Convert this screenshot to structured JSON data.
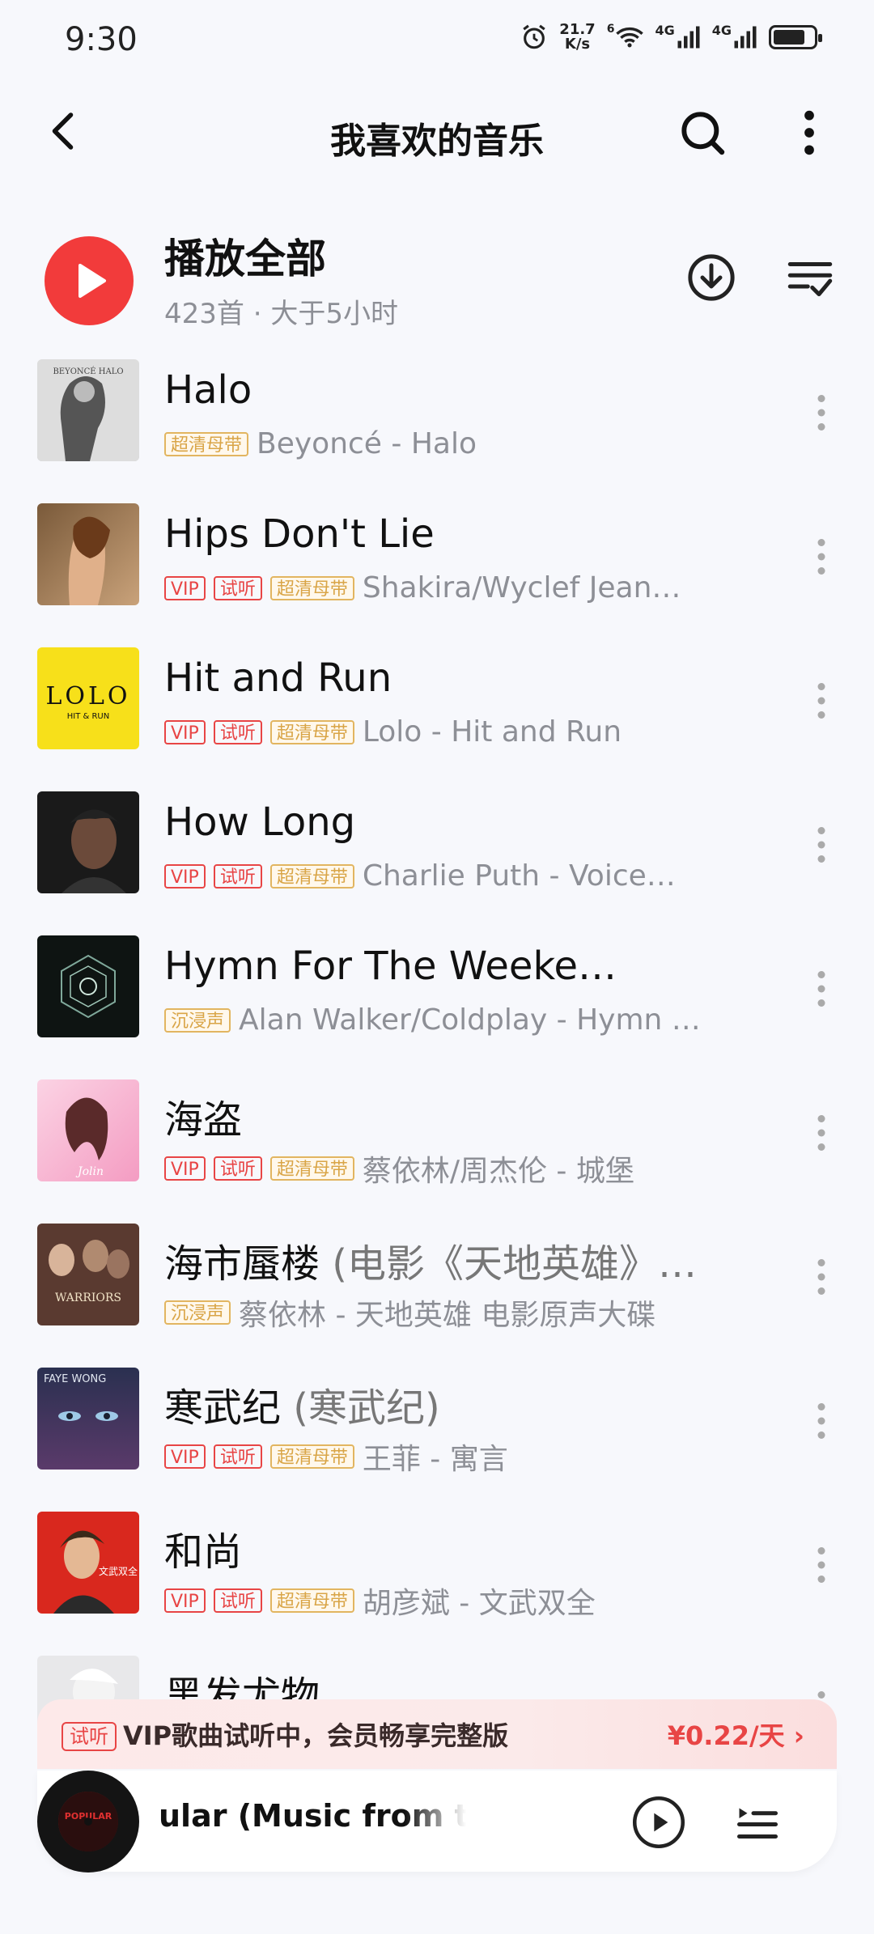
{
  "status_bar": {
    "time": "9:30",
    "net_speed_value": "21.7",
    "net_speed_unit": "K/s",
    "wifi_label": "6",
    "signal1": "4G",
    "signal2": "4G",
    "icons": [
      "alarm-icon",
      "wifi-icon",
      "signal-icon",
      "signal-icon",
      "battery-icon"
    ]
  },
  "header": {
    "title": "我喜欢的音乐",
    "back_icon": "chevron-left-icon",
    "search_icon": "search-icon",
    "more_icon": "more-vertical-icon"
  },
  "play_all": {
    "label": "播放全部",
    "subtitle": "423首 · 大于5小时",
    "download_icon": "download-icon",
    "multiselect_icon": "multiselect-icon"
  },
  "songs": [
    {
      "title": "Halo",
      "title_alt": "",
      "tags": [
        "超清母带"
      ],
      "artist": "Beyoncé - Halo"
    },
    {
      "title": "Hips Don't Lie",
      "title_alt": "",
      "tags": [
        "VIP",
        "试听",
        "超清母带"
      ],
      "artist": "Shakira/Wyclef Jean…"
    },
    {
      "title": "Hit and Run",
      "title_alt": "",
      "tags": [
        "VIP",
        "试听",
        "超清母带"
      ],
      "artist": "Lolo - Hit and Run"
    },
    {
      "title": "How Long",
      "title_alt": "",
      "tags": [
        "VIP",
        "试听",
        "超清母带"
      ],
      "artist": "Charlie Puth - Voice…"
    },
    {
      "title": "Hymn For The Weeke…",
      "title_alt": "",
      "tags": [
        "沉浸声"
      ],
      "artist": "Alan Walker/Coldplay - Hymn …"
    },
    {
      "title": "海盗",
      "title_alt": "",
      "tags": [
        "VIP",
        "试听",
        "超清母带"
      ],
      "artist": "蔡依林/周杰伦 - 城堡"
    },
    {
      "title": "海市蜃楼",
      "title_alt": " (电影《天地英雄》…",
      "tags": [
        "沉浸声"
      ],
      "artist": "蔡依林 - 天地英雄 电影原声大碟"
    },
    {
      "title": "寒武纪",
      "title_alt": " (寒武纪)",
      "tags": [
        "VIP",
        "试听",
        "超清母带"
      ],
      "artist": "王菲 - 寓言"
    },
    {
      "title": "和尚",
      "title_alt": "",
      "tags": [
        "VIP",
        "试听",
        "超清母带"
      ],
      "artist": "胡彦斌 - 文武双全"
    },
    {
      "title": "黑发尤物",
      "title_alt": "",
      "tags": [],
      "artist": ""
    }
  ],
  "cover_texts": {
    "halo": "BEYONCÉ HALO",
    "lolo": "LOLO",
    "lolo_sub": "HIT & RUN",
    "faye": "FAYE WONG",
    "warriors": "WARRIORS",
    "hushang": "文武双全",
    "pirate": "Jolin"
  },
  "trial_banner": {
    "tag": "试听",
    "text": "VIP歌曲试听中，会员畅享完整版",
    "price": "¥0.22/天 ›"
  },
  "player": {
    "track": "ular (Music from t",
    "disc_label": "POPULAR",
    "play_icon": "play-circle-icon",
    "queue_icon": "playlist-icon"
  },
  "colors": {
    "accent": "#f23b3b",
    "vip_red": "#e84545",
    "hq_gold": "#d9a547",
    "background": "#f7f8fc"
  }
}
